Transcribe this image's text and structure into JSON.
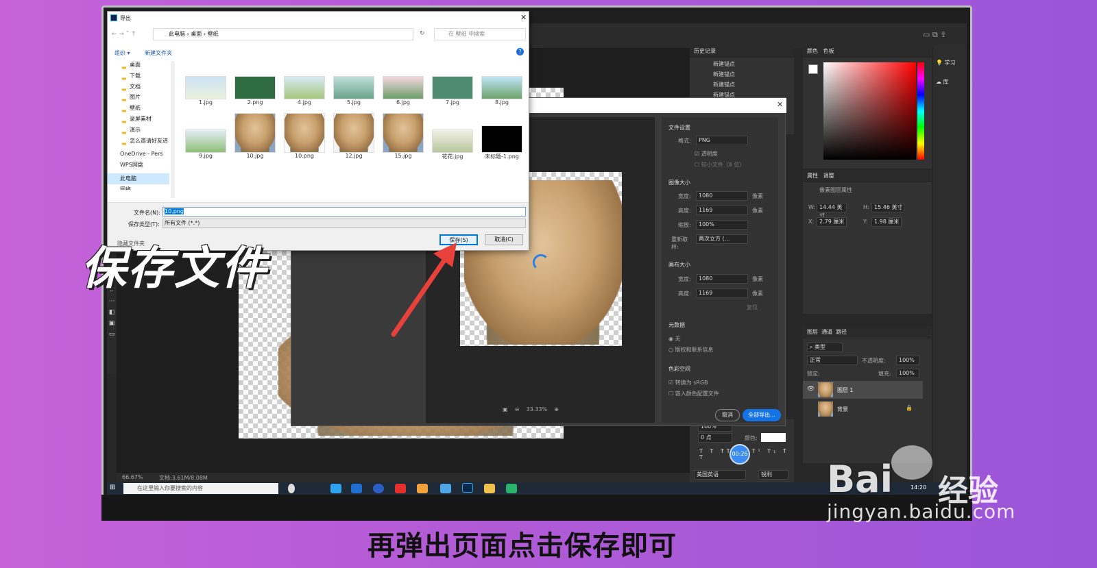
{
  "overlay": {
    "title": "保存文件",
    "subtitle": "再弹出页面点击保存即可",
    "watermark_domain": "jingyan.baidu.com",
    "watermark_cn": "经验",
    "watermark_logo": "Bai"
  },
  "explorer": {
    "title": "导出",
    "breadcrumb": [
      "此电脑",
      "桌面",
      "壁纸"
    ],
    "search_placeholder": "在 壁纸 中搜索",
    "toolbar": {
      "organize": "组织 ▾",
      "new_folder": "新建文件夹"
    },
    "sidebar": [
      "桌面",
      "下载",
      "文档",
      "图片",
      "壁纸",
      "录屏素材",
      "演示",
      "怎么邀请好友进",
      "OneDrive - Pers",
      "WPS网盘",
      "此电脑",
      "网络"
    ],
    "files_row1": [
      "1.jpg",
      "2.png",
      "4.jpg",
      "5.jpg",
      "6.jpg",
      "7.jpg",
      "8.jpg"
    ],
    "files_row2": [
      "9.jpg",
      "10.jpg",
      "10.png",
      "12.jpg",
      "15.jpg",
      "花花.jpg",
      "未标题-1.png"
    ],
    "filename_label": "文件名(N):",
    "filename_value": "10.png",
    "filetype_label": "保存类型(T):",
    "filetype_value": "所有文件 (*.*)",
    "hide_folders": "隐藏文件夹",
    "save_button": "保存(S)",
    "cancel_button": "取消(C)"
  },
  "export_dialog": {
    "file_settings": "文件设置",
    "format_label": "格式:",
    "format_value": "PNG",
    "transparency": "透明度",
    "smaller_file": "较小文件（8 位）",
    "image_size": "图像大小",
    "width_label": "宽度:",
    "width_value": "1080",
    "height_label": "高度:",
    "height_value": "1169",
    "unit": "像素",
    "scale_label": "缩放:",
    "scale_value": "100%",
    "resample_label": "重新取样:",
    "resample_value": "两次立方 (...",
    "canvas_size": "画布大小",
    "canvas_width": "1080",
    "canvas_height": "1169",
    "reset": "复位",
    "metadata": "元数据",
    "meta_none": "无",
    "meta_copyright": "版权和联系信息",
    "color_space": "色彩空间",
    "srgb": "转换为 sRGB",
    "embed_profile": "嵌入颜色配置文件",
    "zoom": "33.33%",
    "cancel": "取消",
    "export_all": "全部导出..."
  },
  "photoshop": {
    "history_tab": "历史记录",
    "history_items": [
      "新建锚点",
      "新建锚点",
      "新建锚点",
      "新建锚点"
    ],
    "color_tab": "颜色",
    "swatches_tab": "色板",
    "learn": "学习",
    "library": "库",
    "props_tab": "属性",
    "adjust_tab": "调整",
    "pixel_layer": "像素图层属性",
    "w_label": "W:",
    "w_value": "14.44 英寸",
    "h_label": "H:",
    "h_value": "15.46 英寸",
    "x_label": "X:",
    "x_value": "2.79 厘米",
    "y_label": "Y:",
    "y_value": "1.98 厘米",
    "layers_tab": "图层",
    "channels_tab": "通道",
    "paths_tab": "路径",
    "kind": "类型",
    "blend": "正常",
    "opacity_label": "不透明度:",
    "opacity_value": "100%",
    "lock_label": "锁定:",
    "fill_label": "填充:",
    "fill_value": "100%",
    "layers": [
      "图层 1",
      "背景"
    ],
    "status_zoom": "66.67%",
    "status_doc": "文档:3.61M/8.08M",
    "char_lang": "美国英语",
    "char_aa": "锐利",
    "char_size1": "100%",
    "char_size2": "0 点",
    "char_color": "颜色:",
    "timer": "00:26"
  },
  "taskbar": {
    "search": "在这里输入你要搜索的内容",
    "time": "14:20"
  },
  "colors": {
    "accent_red": "#e8403a",
    "ps_blue": "#1473e6"
  }
}
